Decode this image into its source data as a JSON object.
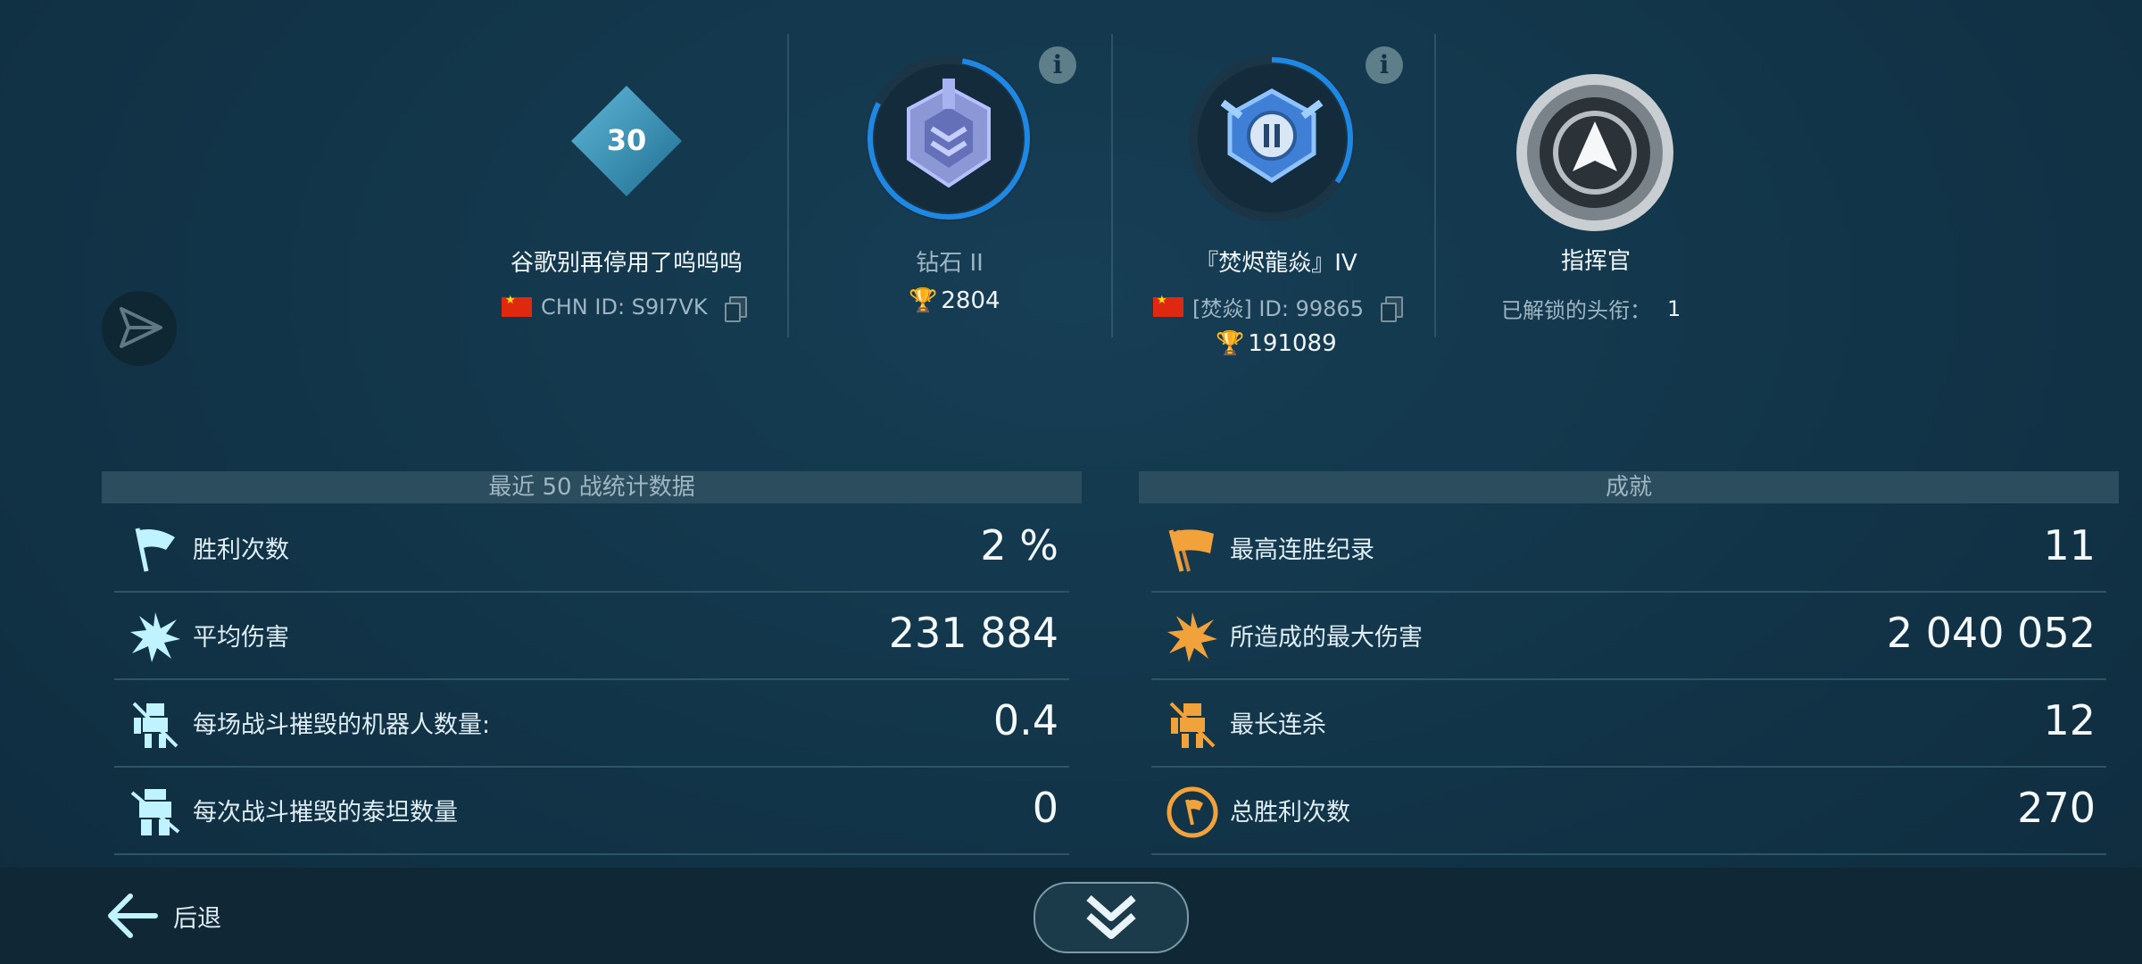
{
  "player": {
    "level": "30",
    "name": "谷歌别再停用了呜呜呜",
    "id_text": "CHN ID: S9I7VK"
  },
  "league": {
    "name": "钻石 II",
    "trophies": "2804"
  },
  "clan": {
    "name": "『焚烬龍焱』IV",
    "tag_text": "[焚焱]  ID: 99865",
    "trophies": "191089"
  },
  "title_card": {
    "name": "指挥官",
    "unlocked_label": "已解锁的头衔：",
    "unlocked_count": "1"
  },
  "stats": {
    "header": "最近 50 战统计数据",
    "rows": [
      {
        "label": "胜利次数",
        "value": "2 %",
        "icon": "flag-icon"
      },
      {
        "label": "平均伤害",
        "value": "231 884",
        "icon": "explosion-icon"
      },
      {
        "label": "每场战斗摧毁的机器人数量:",
        "value": "0.4",
        "icon": "robot-destroyed-icon"
      },
      {
        "label": "每次战斗摧毁的泰坦数量",
        "value": "0",
        "icon": "titan-destroyed-icon"
      }
    ]
  },
  "achievements": {
    "header": "成就",
    "rows": [
      {
        "label": "最高连胜纪录",
        "value": "11",
        "icon": "flags-streak-icon"
      },
      {
        "label": "所造成的最大伤害",
        "value": "2 040 052",
        "icon": "explosion-icon"
      },
      {
        "label": "最长连杀",
        "value": "12",
        "icon": "robot-destroyed-icon"
      },
      {
        "label": "总胜利次数",
        "value": "270",
        "icon": "victory-medal-icon"
      }
    ]
  },
  "bottom": {
    "back_label": "后退"
  },
  "colors": {
    "background": "#123448",
    "accent_blue": "#1e88e5",
    "stat_icon": "#bff3ff",
    "achievement_icon": "#f2a23a",
    "trophy": "#f2b531"
  }
}
